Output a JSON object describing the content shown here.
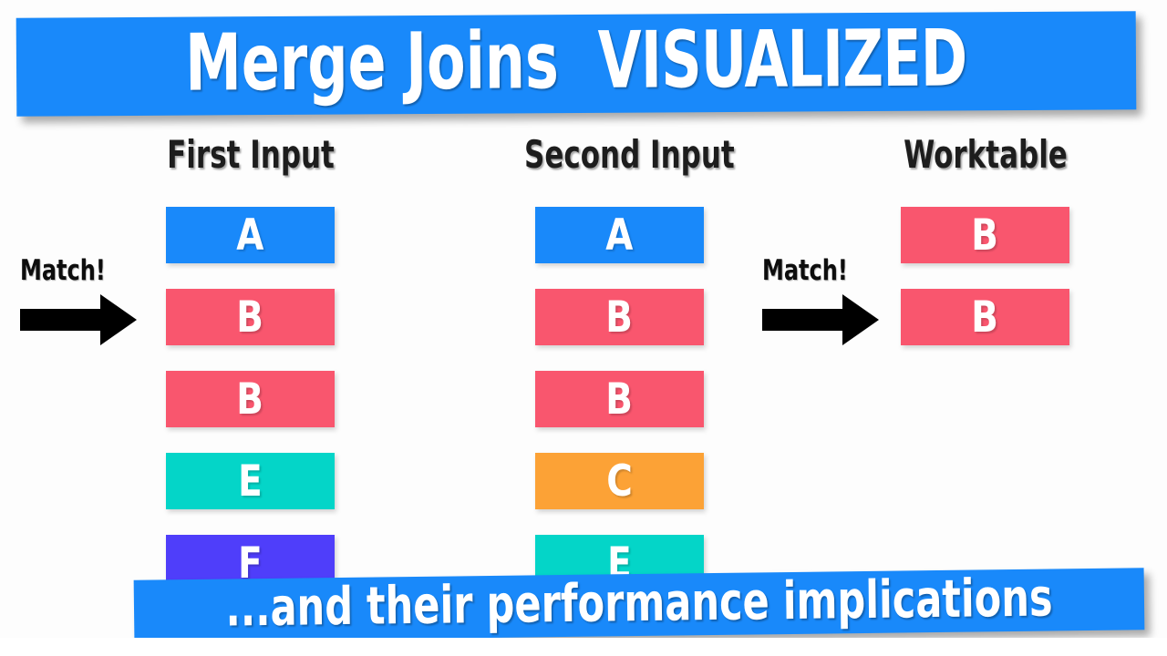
{
  "title_banner": {
    "text_main": "Merge Joins",
    "text_emphasis": "VISUALIZED",
    "background_color": "#1989fa",
    "text_color": "#ffffff"
  },
  "bottom_banner": {
    "text": "...and their performance implications",
    "background_color": "#1989fa",
    "text_color": "#ffffff"
  },
  "columns": [
    {
      "header": "First Input",
      "blocks": [
        {
          "label": "A",
          "color": "#1989fa"
        },
        {
          "label": "B",
          "color": "#f9566e"
        },
        {
          "label": "B",
          "color": "#f9566e"
        },
        {
          "label": "E",
          "color": "#04d5c8"
        },
        {
          "label": "F",
          "color": "#4f3efa"
        }
      ]
    },
    {
      "header": "Second Input",
      "blocks": [
        {
          "label": "A",
          "color": "#1989fa"
        },
        {
          "label": "B",
          "color": "#f9566e"
        },
        {
          "label": "B",
          "color": "#f9566e"
        },
        {
          "label": "C",
          "color": "#fca236"
        },
        {
          "label": "E",
          "color": "#04d5c8"
        }
      ]
    },
    {
      "header": "Worktable",
      "blocks": [
        {
          "label": "B",
          "color": "#f9566e"
        },
        {
          "label": "B",
          "color": "#f9566e"
        }
      ]
    }
  ],
  "annotations": [
    {
      "id": "match-left",
      "label": "Match!",
      "icon": "right-arrow-icon",
      "color": "#000000"
    },
    {
      "id": "match-right",
      "label": "Match!",
      "icon": "right-arrow-icon",
      "color": "#000000"
    }
  ]
}
